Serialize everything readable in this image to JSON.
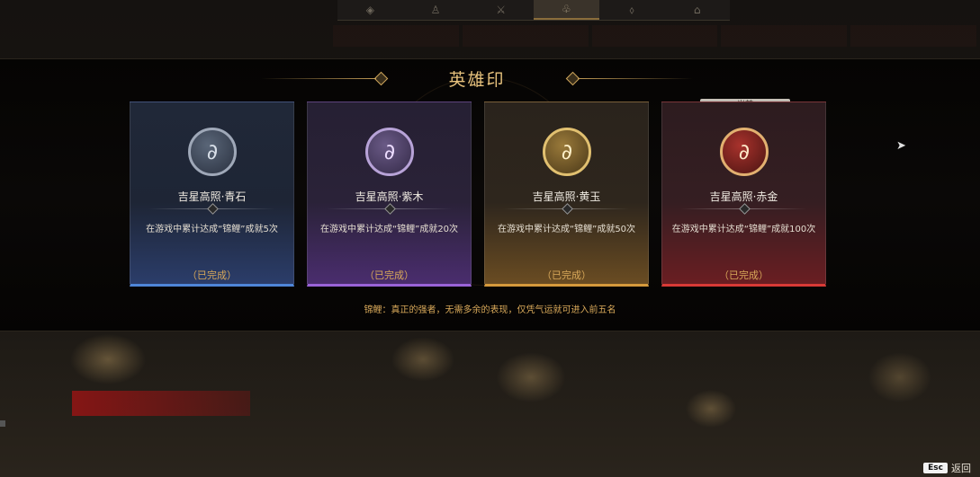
{
  "top_nav": {
    "tabs": [
      "◈",
      "♙",
      "⚔",
      "♧",
      "⬨",
      "⌂"
    ],
    "active_index": 3
  },
  "sub_nav": [
    "",
    "",
    "",
    "",
    ""
  ],
  "modal": {
    "title": "英雄印",
    "current_tag": "当前",
    "footnote": "锦鲤：真正的强者，无需多余的表现，仅凭气运就可进入前五名",
    "cards": [
      {
        "name": "吉星高照·青石",
        "desc": "在游戏中累计达成“锦鲤”成就5次",
        "status": "（已完成）",
        "tier_color": "#4f86d8"
      },
      {
        "name": "吉星高照·紫木",
        "desc": "在游戏中累计达成“锦鲤”成就20次",
        "status": "（已完成）",
        "tier_color": "#9a63d8"
      },
      {
        "name": "吉星高照·黄玉",
        "desc": "在游戏中累计达成“锦鲤”成就50次",
        "status": "（已完成）",
        "tier_color": "#d69a3c"
      },
      {
        "name": "吉星高照·赤金",
        "desc": "在游戏中累计达成“锦鲤”成就100次",
        "status": "（已完成）",
        "tier_color": "#d83a36"
      }
    ]
  },
  "background": {
    "red_button": "",
    "chatlog": [
      "",
      "",
      "",
      ""
    ]
  },
  "footer": {
    "esc_key": "Esc",
    "esc_label": "返回"
  },
  "icons": {
    "medal": "koi-medal-icon",
    "cursor": "mouse-cursor-icon"
  }
}
